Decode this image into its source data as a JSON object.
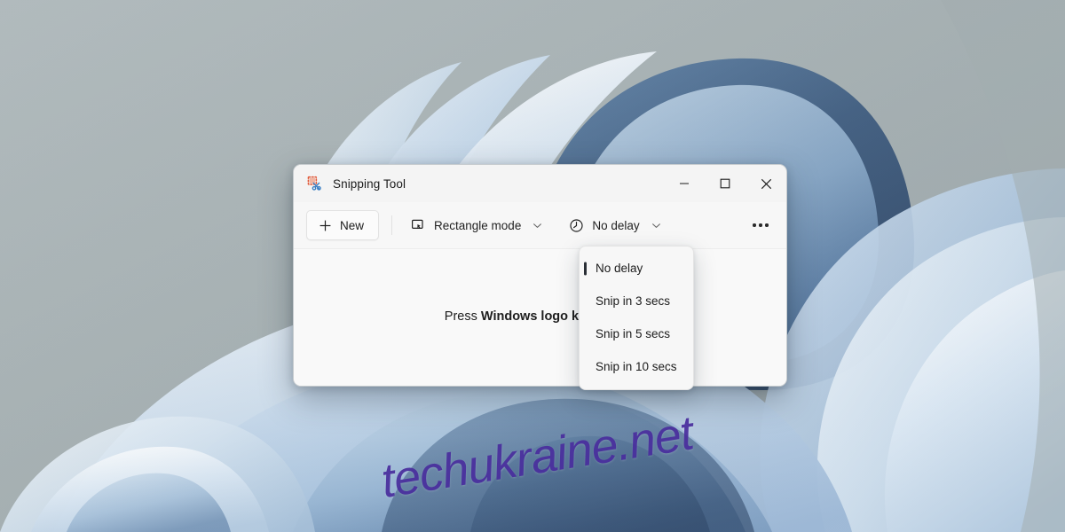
{
  "window": {
    "title": "Snipping Tool",
    "app_icon": "snipping-tool-icon",
    "caption": {
      "minimize": "minimize-icon",
      "maximize": "maximize-icon",
      "close": "close-icon"
    }
  },
  "toolbar": {
    "new_label": "New",
    "new_icon": "plus-icon",
    "mode_label": "Rectangle mode",
    "mode_icon": "rectangle-snip-icon",
    "mode_chevron": "chevron-down-icon",
    "delay_label": "No delay",
    "delay_icon": "clock-icon",
    "delay_chevron": "chevron-down-icon",
    "more_label": "See more",
    "more_icon": "ellipsis-icon"
  },
  "content": {
    "hint_prefix": "Press ",
    "hint_shortcut": "Windows logo key + Shif",
    "hint_suffix": "."
  },
  "delay_menu": {
    "selected": "No delay",
    "items": [
      {
        "label": "No delay",
        "selected": true
      },
      {
        "label": "Snip in 3 secs",
        "selected": false
      },
      {
        "label": "Snip in 5 secs",
        "selected": false
      },
      {
        "label": "Snip in 10 secs",
        "selected": false
      }
    ]
  },
  "watermark": {
    "text": "techukraine.net",
    "color": "#4a2f9e"
  },
  "desktop": {
    "wallpaper_name": "windows-11-bloom-wallpaper",
    "colors": {
      "sky_gray": "#a9b3b5",
      "petal_light": "#dbe6f1",
      "petal_mid": "#9fb8d4",
      "petal_deep": "#3c5878",
      "petal_deepest": "#2b4260"
    }
  }
}
